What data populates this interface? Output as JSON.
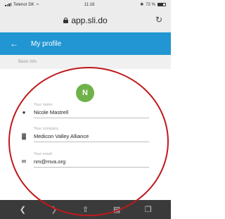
{
  "status_bar": {
    "carrier": "Telenor DK",
    "time": "11:16",
    "battery": "72 %",
    "battery_level": 0.72
  },
  "browser": {
    "url": "app.sli.do",
    "icons": [
      "lock-icon",
      "reload-icon"
    ]
  },
  "header": {
    "title": "My profile",
    "back_icon": "back-arrow-icon",
    "accent_color": "#2196d3"
  },
  "section": {
    "label": "Basic info"
  },
  "avatar": {
    "initial": "N",
    "color": "#70b24a"
  },
  "fields": [
    {
      "label": "Your name",
      "value": "Nicole Mastrell",
      "icon": "person-icon"
    },
    {
      "label": "Your company",
      "value": "Medicon Valley Alliance",
      "icon": "building-icon"
    },
    {
      "label": "Your email",
      "value": "nm@mva.org",
      "icon": "mail-icon"
    }
  ],
  "toolbar": {
    "icons": [
      "back-icon",
      "share-icon",
      "bookmarks-icon",
      "tabs-icon"
    ]
  },
  "annotation": {
    "shape": "ellipse",
    "color": "#c0191c"
  }
}
